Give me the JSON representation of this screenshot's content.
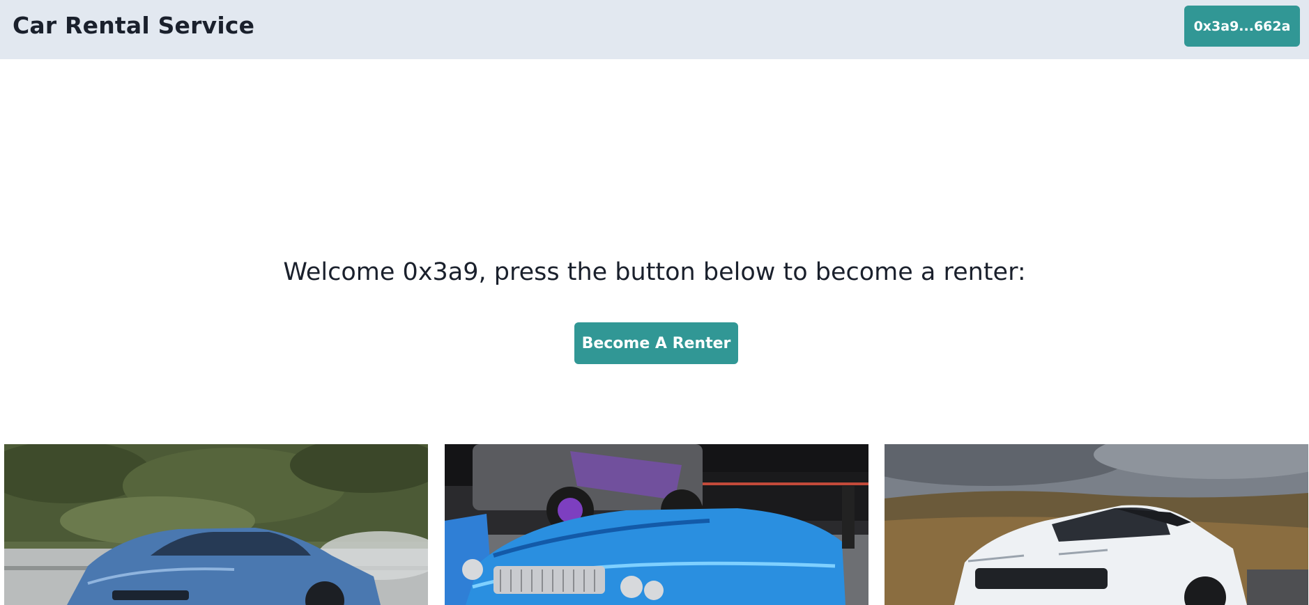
{
  "header": {
    "title": "Car Rental Service",
    "wallet_label": "0x3a9...662a"
  },
  "main": {
    "welcome_text": "Welcome 0x3a9, press the button below to become a renter:",
    "become_renter_label": "Become A Renter"
  },
  "gallery": {
    "images": [
      "blue-sports-coupe-photo",
      "blue-lowrider-convertible-photo",
      "white-suv-photo"
    ]
  },
  "colors": {
    "header_bg": "#e2e8f0",
    "accent": "#319795",
    "text": "#1a202c"
  }
}
